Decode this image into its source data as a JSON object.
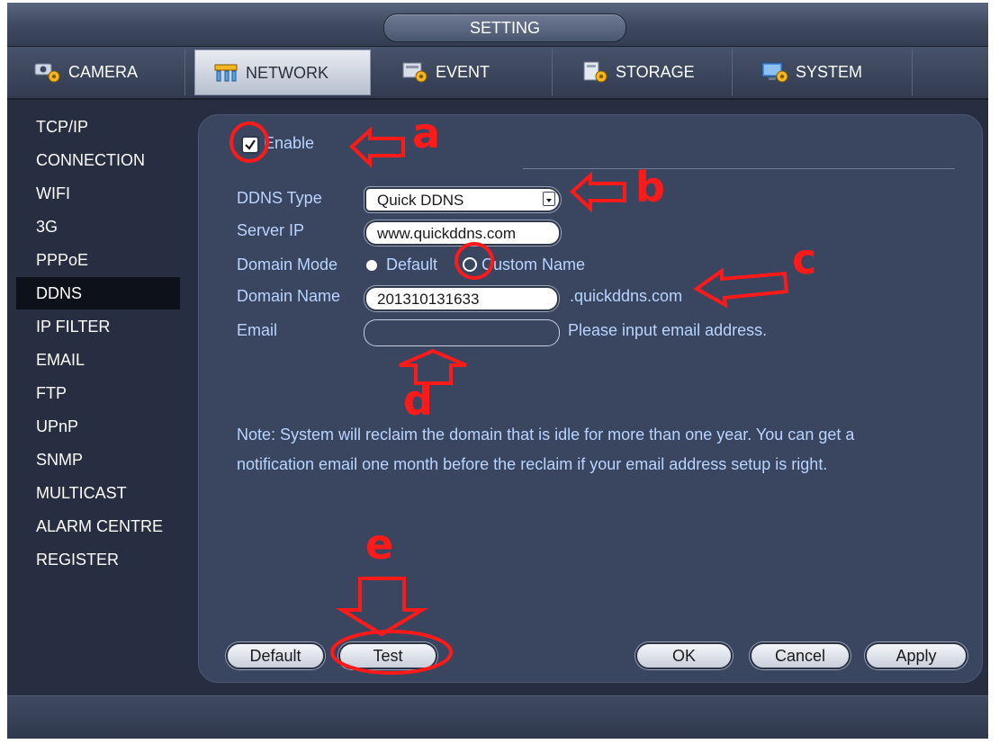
{
  "title": "SETTING",
  "tabs": [
    {
      "label": "CAMERA",
      "icon": "camera-gear-icon"
    },
    {
      "label": "NETWORK",
      "icon": "network-icon"
    },
    {
      "label": "EVENT",
      "icon": "event-icon"
    },
    {
      "label": "STORAGE",
      "icon": "storage-icon"
    },
    {
      "label": "SYSTEM",
      "icon": "system-monitor-icon"
    }
  ],
  "active_tab": "NETWORK",
  "sidebar": {
    "items": [
      "TCP/IP",
      "CONNECTION",
      "WIFI",
      "3G",
      "PPPoE",
      "DDNS",
      "IP FILTER",
      "EMAIL",
      "FTP",
      "UPnP",
      "SNMP",
      "MULTICAST",
      "ALARM CENTRE",
      "REGISTER"
    ],
    "active": "DDNS"
  },
  "form": {
    "enable_label": "Enable",
    "enable_checked": true,
    "ddns_type_label": "DDNS Type",
    "ddns_type_value": "Quick DDNS",
    "server_ip_label": "Server IP",
    "server_ip_value": "www.quickddns.com",
    "domain_mode_label": "Domain Mode",
    "domain_mode_default": "Default",
    "domain_mode_custom": "Custom Name",
    "domain_mode_selected": "Default",
    "domain_name_label": "Domain Name",
    "domain_name_value": "201310131633",
    "domain_suffix": ".quickddns.com",
    "email_label": "Email",
    "email_value": "",
    "email_hint": "Please input email address.",
    "note_line1": "Note: System will reclaim the domain that is idle for more than one year. You can get a",
    "note_line2": "notification email one month before the reclaim if your email address setup is right."
  },
  "buttons": {
    "default": "Default",
    "test": "Test",
    "ok": "OK",
    "cancel": "Cancel",
    "apply": "Apply"
  },
  "annotations": {
    "a": "a",
    "b": "b",
    "c": "c",
    "d": "d",
    "e": "e",
    "color": "#ff1a1a"
  },
  "colors": {
    "background": "#272e41",
    "panel": "#3a4560",
    "label_text": "#b8d4ff"
  }
}
